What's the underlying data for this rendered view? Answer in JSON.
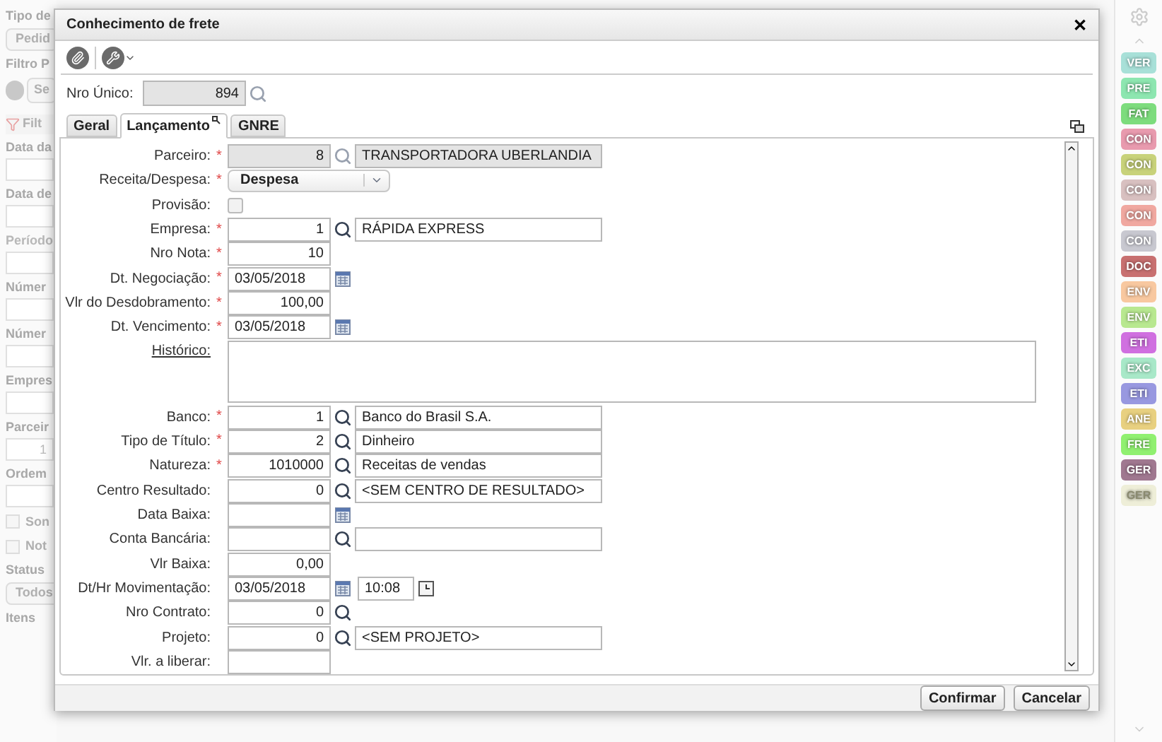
{
  "background_panel": {
    "items": [
      {
        "kind": "heading",
        "text": "Tipo de"
      },
      {
        "kind": "button",
        "text": "Pedid"
      },
      {
        "kind": "heading",
        "text": "Filtro P"
      },
      {
        "kind": "iconbutton",
        "text": "Se"
      },
      {
        "kind": "filter",
        "text": "Filt"
      },
      {
        "kind": "heading",
        "text": "Data da"
      },
      {
        "kind": "field"
      },
      {
        "kind": "heading",
        "text": "Data de"
      },
      {
        "kind": "field"
      },
      {
        "kind": "dim",
        "text": "Período"
      },
      {
        "kind": "field"
      },
      {
        "kind": "heading",
        "text": "Númer"
      },
      {
        "kind": "field"
      },
      {
        "kind": "heading",
        "text": "Númer"
      },
      {
        "kind": "field"
      },
      {
        "kind": "heading",
        "text": "Empres"
      },
      {
        "kind": "field"
      },
      {
        "kind": "heading",
        "text": "Parceir"
      },
      {
        "kind": "field",
        "text": "1"
      },
      {
        "kind": "heading",
        "text": "Ordem"
      },
      {
        "kind": "field"
      },
      {
        "kind": "check",
        "text": "Son",
        "checked": false
      },
      {
        "kind": "check",
        "text": "Not",
        "checked": false
      },
      {
        "kind": "heading",
        "text": "Status"
      },
      {
        "kind": "button",
        "text": "Todos"
      },
      {
        "kind": "heading",
        "text": "Itens"
      }
    ]
  },
  "dialog": {
    "title": "Conhecimento de frete",
    "close": "✕",
    "required_mark": "*",
    "nro_unico": {
      "label": "Nro Único:",
      "value": "894"
    },
    "tabs": [
      {
        "label": "Geral",
        "selected": false
      },
      {
        "label": "Lançamento",
        "selected": true
      },
      {
        "label": "GNRE",
        "selected": false
      }
    ],
    "fields": [
      {
        "kind": "lookup",
        "label": "Parceiro:",
        "required": true,
        "readonly": true,
        "value": "8",
        "description": "TRANSPORTADORA UBERLANDIA"
      },
      {
        "kind": "select",
        "label": "Receita/Despesa:",
        "required": true,
        "value": "Despesa"
      },
      {
        "kind": "checkbox",
        "label": "Provisão:",
        "required": false,
        "checked": false
      },
      {
        "kind": "lookup",
        "label": "Empresa:",
        "required": true,
        "readonly": false,
        "value": "1",
        "description": "RÁPIDA EXPRESS"
      },
      {
        "kind": "number",
        "label": "Nro Nota:",
        "required": true,
        "value": "10"
      },
      {
        "kind": "date",
        "label": "Dt. Negociação:",
        "required": true,
        "value": "03/05/2018"
      },
      {
        "kind": "number",
        "label": "Vlr do Desdobramento:",
        "required": true,
        "value": "100,00"
      },
      {
        "kind": "date",
        "label": "Dt. Vencimento:",
        "required": true,
        "value": "03/05/2018"
      },
      {
        "kind": "textarea",
        "label": "Histórico:",
        "required": false
      },
      {
        "kind": "lookup",
        "label": "Banco:",
        "required": true,
        "readonly": false,
        "value": "1",
        "description": "Banco do Brasil S.A."
      },
      {
        "kind": "lookup",
        "label": "Tipo de Título:",
        "required": true,
        "readonly": false,
        "value": "2",
        "description": "Dinheiro"
      },
      {
        "kind": "lookup",
        "label": "Natureza:",
        "required": true,
        "readonly": false,
        "value": "1010000",
        "description": "Receitas de vendas"
      },
      {
        "kind": "lookup",
        "label": "Centro Resultado:",
        "required": false,
        "readonly": false,
        "value": "0",
        "description": "<SEM CENTRO DE RESULTADO>"
      },
      {
        "kind": "date",
        "label": "Data Baixa:",
        "required": false
      },
      {
        "kind": "lookup",
        "label": "Conta Bancária:",
        "required": false,
        "readonly": false
      },
      {
        "kind": "number",
        "label": "Vlr Baixa:",
        "required": false,
        "value": "0,00"
      },
      {
        "kind": "datetime",
        "label": "Dt/Hr Movimentação:",
        "required": false,
        "value": "03/05/2018",
        "time": "10:08"
      },
      {
        "kind": "code",
        "label": "Nro Contrato:",
        "required": false,
        "value": "0"
      },
      {
        "kind": "lookup",
        "label": "Projeto:",
        "required": false,
        "readonly": false,
        "value": "0",
        "description": "<SEM PROJETO>"
      },
      {
        "kind": "number",
        "label": "Vlr. a liberar:",
        "required": false
      }
    ],
    "buttons": [
      "Confirmar",
      "Cancelar"
    ]
  },
  "side_buttons": [
    {
      "label": "VER",
      "color": "#a8e0d8"
    },
    {
      "label": "PRE",
      "color": "#8de6b0"
    },
    {
      "label": "FAT",
      "color": "#7ddc7d"
    },
    {
      "label": "CON",
      "color": "#e89aae"
    },
    {
      "label": "CON",
      "color": "#c8d27a"
    },
    {
      "label": "CON",
      "color": "#d8c0c0"
    },
    {
      "label": "CON",
      "color": "#f0a8a0"
    },
    {
      "label": "CON",
      "color": "#c8c8d0"
    },
    {
      "label": "DOC",
      "color": "#c87070"
    },
    {
      "label": "ENV",
      "color": "#f8c8a0"
    },
    {
      "label": "ENV",
      "color": "#b8e890"
    },
    {
      "label": "ETI",
      "color": "#d070e0"
    },
    {
      "label": "EXC",
      "color": "#a8e8c8"
    },
    {
      "label": "ETI",
      "color": "#9898e0"
    },
    {
      "label": "ANE",
      "color": "#e8d080"
    },
    {
      "label": "FRE",
      "color": "#90f070"
    },
    {
      "label": "GER",
      "color": "#a07890"
    },
    {
      "label": "GER",
      "color": "#eeeed8"
    }
  ]
}
